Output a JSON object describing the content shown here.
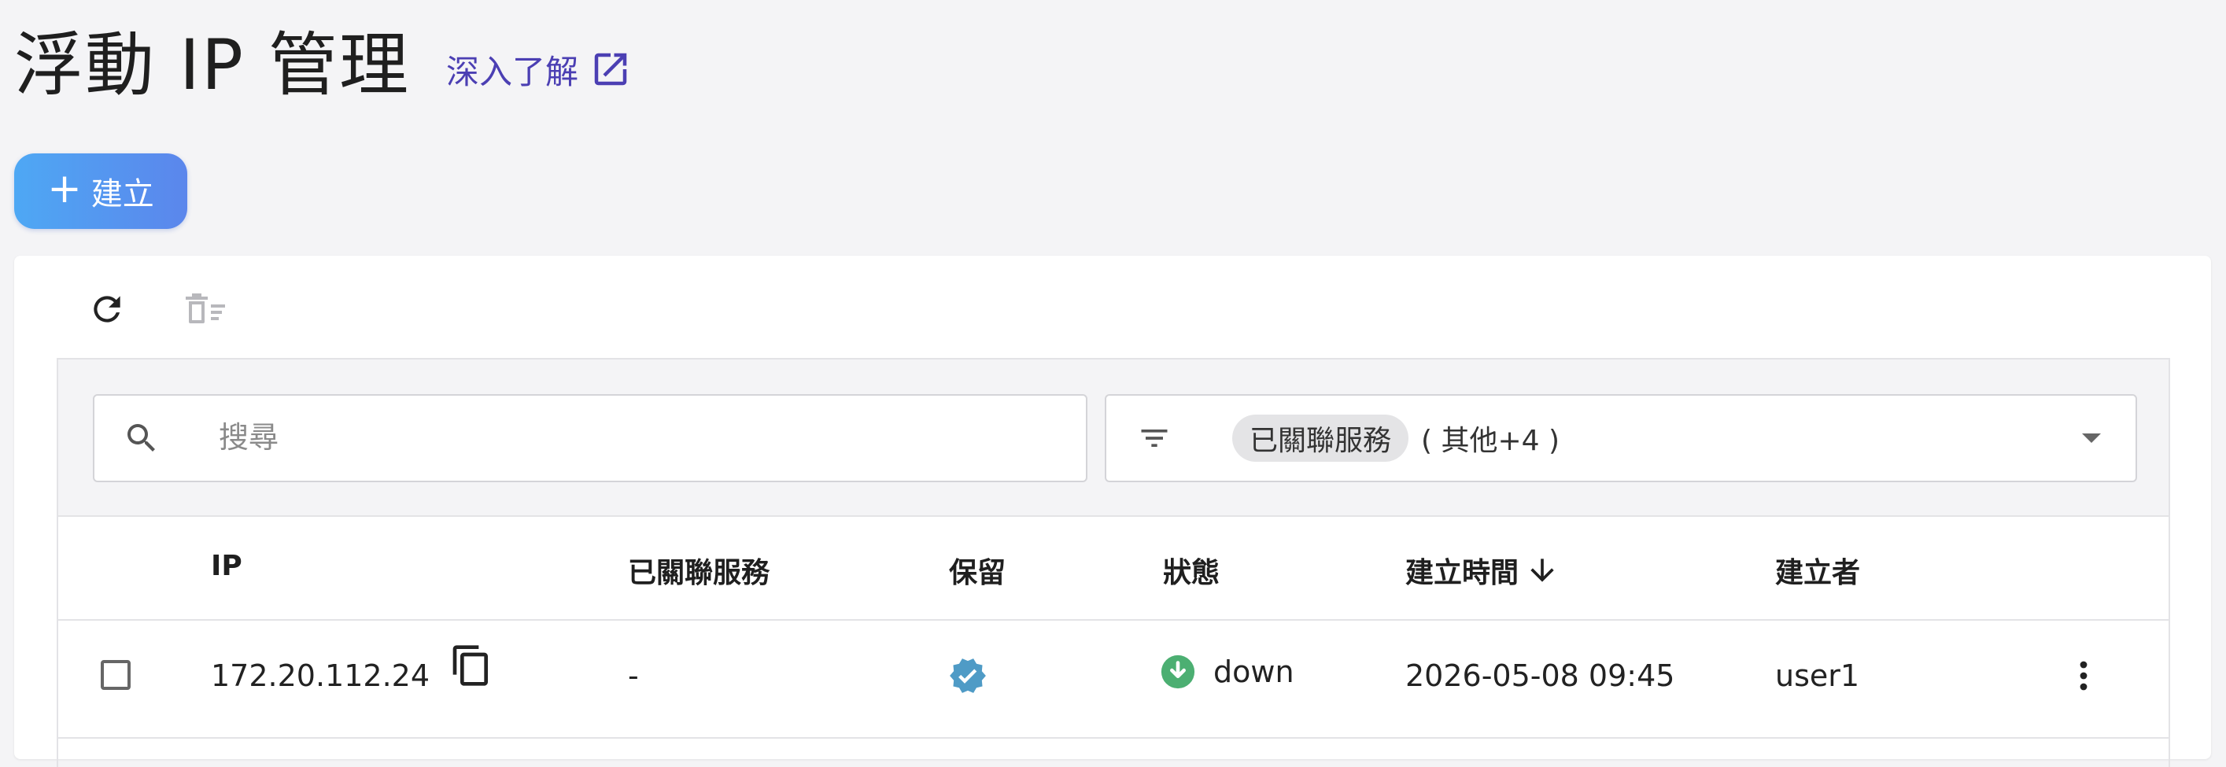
{
  "header": {
    "title": "浮動 IP 管理",
    "learn_more": "深入了解"
  },
  "actions": {
    "create_label": "建立"
  },
  "filters": {
    "search_placeholder": "搜尋",
    "active_filter": "已關聯服務",
    "more_filters": "( 其他+4 )"
  },
  "table": {
    "columns": {
      "ip": "IP",
      "associated_service": "已關聯服務",
      "reserved": "保留",
      "status": "狀態",
      "created_at": "建立時間",
      "creator": "建立者"
    },
    "rows": [
      {
        "ip": "172.20.112.24",
        "associated_service": "-",
        "status": "down",
        "created_at": "2026-05-08 09:45",
        "creator": "user1"
      }
    ]
  },
  "colors": {
    "link": "#4b3fb3",
    "primary_start": "#4ea8f4",
    "primary_end": "#5b86ec",
    "status_down": "#4caf72",
    "reserved_badge": "#4f9bc6"
  },
  "icons": [
    "external-link-icon",
    "plus-icon",
    "refresh-icon",
    "delete-icon",
    "search-icon",
    "filter-icon",
    "sort-down-icon",
    "copy-icon",
    "verified-icon",
    "arrow-down-circle-icon",
    "more-vert-icon"
  ]
}
